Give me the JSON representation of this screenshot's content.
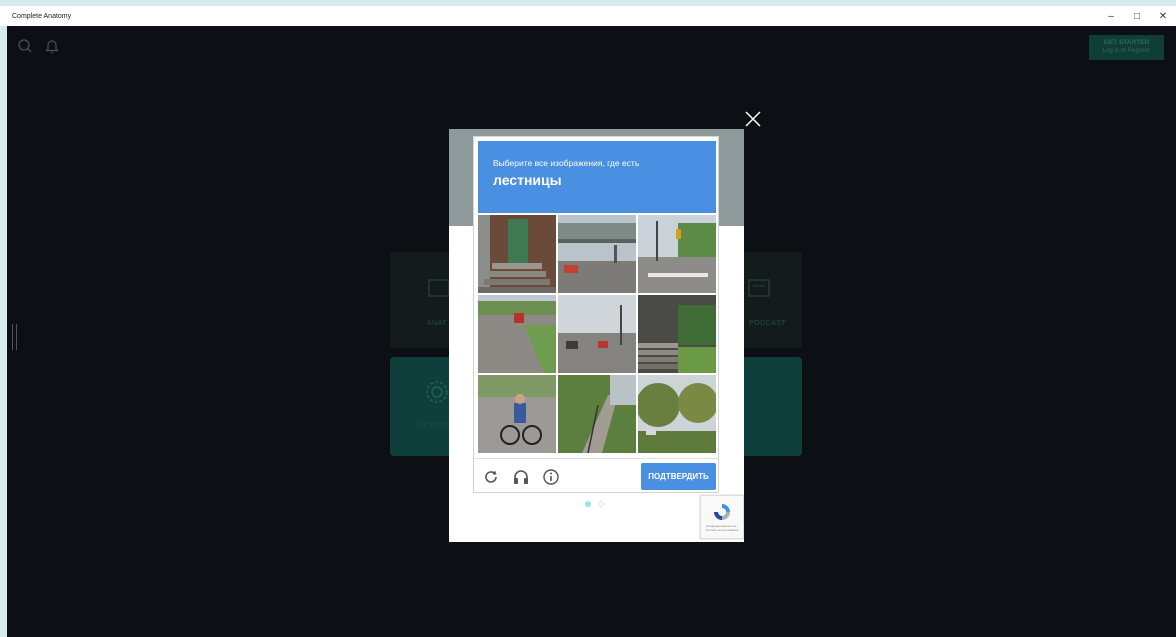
{
  "window": {
    "title": "Complete Anatomy",
    "controls": {
      "minimize": "–",
      "restore": "□",
      "close": "✕"
    }
  },
  "app": {
    "toolbar_icons": [
      "search-icon",
      "bell-icon"
    ],
    "get_started": {
      "label": "GET STARTED",
      "sub": "Log in or Register"
    },
    "tiles": [
      {
        "label": "ANAT",
        "icon": "anatomy-icon"
      },
      {
        "label": "PODCAST",
        "icon": "podcast-icon"
      },
      {
        "label": "SETTINGS",
        "icon": "gear-icon"
      }
    ]
  },
  "captcha": {
    "instruction": "Выберите все изображения, где есть",
    "target": "лестницы",
    "images": [
      "green-door-stairs",
      "highway-overpass",
      "street-crosswalk",
      "road-with-car",
      "intersection",
      "outdoor-stairs",
      "cyclist",
      "stairway-path",
      "tree-road"
    ],
    "tools": [
      "reload-icon",
      "audio-icon",
      "info-icon"
    ],
    "verify_label": "ПОДТВЕРДИТЬ",
    "badge_text": "Конфиденциальность - Условия использования"
  },
  "pagination": {
    "count": 2,
    "active": 0
  },
  "colors": {
    "accent": "#4a90e2",
    "app_bg": "#0c1014",
    "teal_tile": "#0e3f3a",
    "dot_active": "#9fe3e2",
    "dot_inactive": "#cfecec"
  }
}
